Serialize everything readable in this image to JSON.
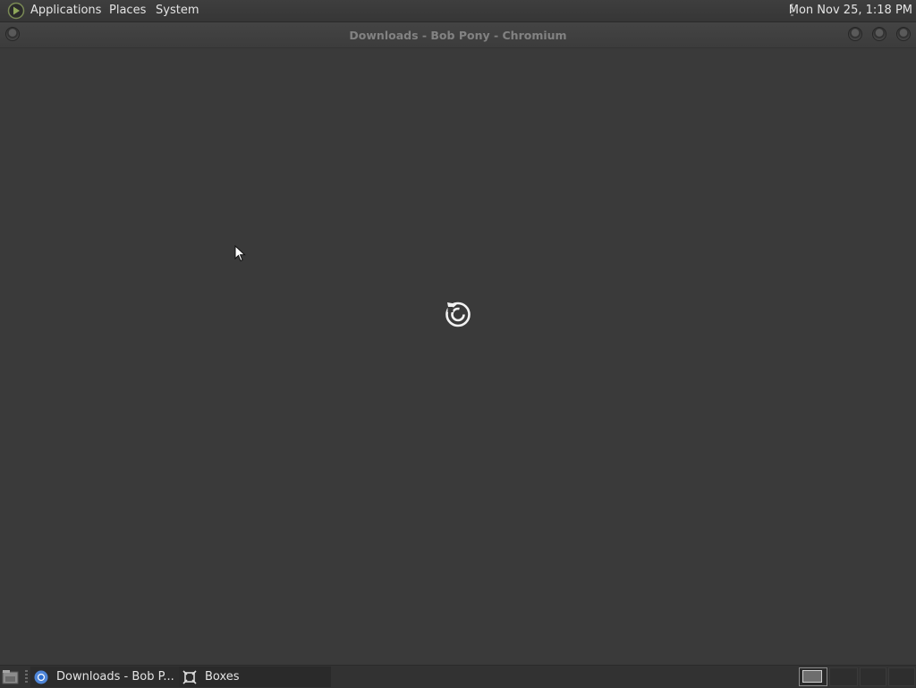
{
  "top_panel": {
    "menus": [
      "Applications",
      "Places",
      "System"
    ],
    "clock": "Mon Nov 25,  1:18 PM",
    "logo_icon": "mate-menu-icon"
  },
  "window": {
    "title": "Downloads - Bob Pony - Chromium",
    "content_icon": "reload-icon"
  },
  "taskbar": {
    "tasks": [
      {
        "label": "Downloads - Bob P...",
        "icon": "chromium-icon"
      },
      {
        "label": "Boxes",
        "icon": "boxes-icon"
      }
    ],
    "show_desktop_icon": "show-desktop-icon"
  },
  "colors": {
    "background": "#3a3a3a",
    "panel": "#363636",
    "title_text": "#828282",
    "panel_text": "#e4e4e4"
  }
}
